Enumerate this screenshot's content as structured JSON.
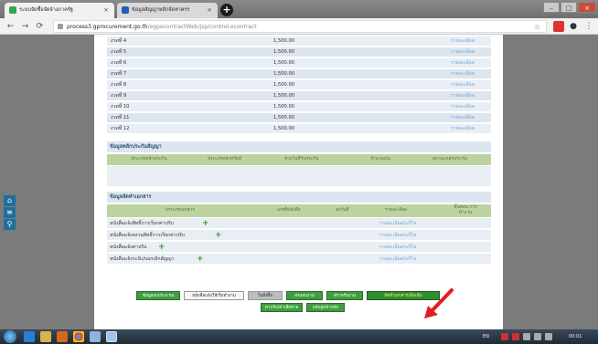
{
  "browser": {
    "tabs": [
      {
        "title": "ระบบจัดซื้อจัดจ้างภาครัฐ",
        "active": true,
        "favicon_color": "#2ea84a"
      },
      {
        "title": "ข้อมูลสัญญาหลักจัดหาครร",
        "active": false,
        "favicon_color": "#1e5fb5"
      }
    ],
    "new_tab_icon": "plus-icon",
    "url_host": "process3.gprocurement.go.th",
    "url_path": "/egpecontractWeb/jsp/control.econtract",
    "window_controls": [
      "minimize-icon",
      "maximize-icon",
      "close-icon"
    ]
  },
  "sidebar_icons": [
    "home-icon",
    "menu-icon",
    "search-icon"
  ],
  "installments": [
    {
      "label": "งวดที่ 4",
      "amount": "1,500.00",
      "link": "รายละเอียด"
    },
    {
      "label": "งวดที่ 5",
      "amount": "1,500.00",
      "link": "รายละเอียด"
    },
    {
      "label": "งวดที่ 6",
      "amount": "1,500.00",
      "link": "รายละเอียด"
    },
    {
      "label": "งวดที่ 7",
      "amount": "1,500.00",
      "link": "รายละเอียด"
    },
    {
      "label": "งวดที่ 8",
      "amount": "1,500.00",
      "link": "รายละเอียด"
    },
    {
      "label": "งวดที่ 9",
      "amount": "1,500.00",
      "link": "รายละเอียด"
    },
    {
      "label": "งวดที่ 10",
      "amount": "1,500.00",
      "link": "รายละเอียด"
    },
    {
      "label": "งวดที่ 11",
      "amount": "1,500.00",
      "link": "รายละเอียด"
    },
    {
      "label": "งวดที่ 12",
      "amount": "1,500.00",
      "link": "รายละเอียด"
    }
  ],
  "guarantee": {
    "title": "ข้อมูลหลักประกันสัญญา",
    "columns": [
      "ประเภทหลักประกัน",
      "ประเภทหลักทรัพย์",
      "ช่วงวันที่รับประกัน",
      "จำนวนเงิน",
      "สถานะหลักประกัน"
    ]
  },
  "documents": {
    "title": "ข้อมูลจัดทำเอกสาร",
    "columns": [
      "ประเภทเอกสาร",
      "เลขที่หนังสือ",
      "ลงวันที่",
      "รายละเอียด",
      "ขั้นตอน การทำงาน"
    ],
    "rows": [
      {
        "name": "หนังสือแจ้งสิทธิ์การเรียกค่าปรับ",
        "link": "รายละเอียด/แก้ไข"
      },
      {
        "name": "หนังสือแจ้งสงวนสิทธิ์การเรียกค่าปรับ",
        "link": "รายละเอียด/แก้ไข"
      },
      {
        "name": "หนังสือแจ้งค่าปรับ",
        "link": "รายละเอียด/แก้ไข"
      },
      {
        "name": "หนังสือแจ้งระงับ/บอกเลิกสัญญา",
        "link": "รายละเอียด/แก้ไข"
      }
    ]
  },
  "actions": {
    "row1": [
      "ข้อมูลงบประมาณ",
      "หนังสือแจ้งให้เริ่มทำงาน",
      "ใบสั่งซื้อ",
      "ส่งมอบงาน",
      "ตรวจรับงาน",
      "จัดทำเอกสารเพิ่มเติม"
    ],
    "row2": [
      "ค่าปรับ/ค่าเสียหาย",
      "กลับสู่หน้าหลัก"
    ],
    "highlighted": "จัดทำเอกสารเพิ่มเติม"
  },
  "taskbar": {
    "lang": "EN",
    "clock": "00:01",
    "apps": [
      "ie-icon",
      "explorer-icon",
      "media-icon",
      "chrome-icon",
      "paint-icon",
      "window-icon"
    ]
  },
  "colors": {
    "accent_green": "#3e9e3e",
    "link_blue": "#6fa8d6",
    "header_green": "#bcd39f",
    "annotation_arrow": "#e02020"
  }
}
